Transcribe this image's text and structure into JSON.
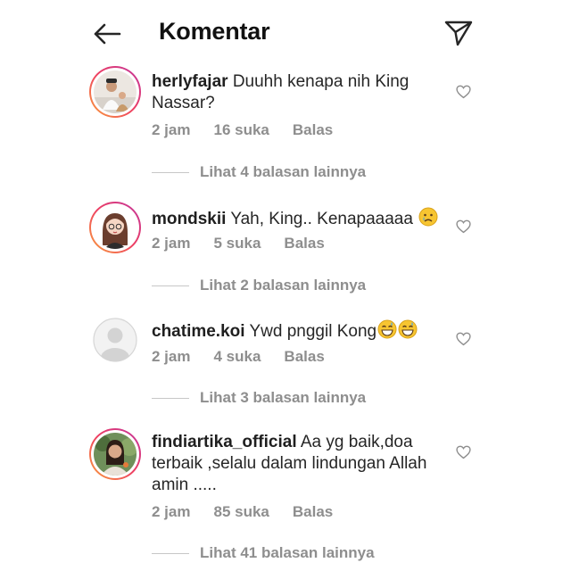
{
  "header": {
    "title": "Komentar",
    "back_icon": "arrow-left-icon",
    "send_icon": "paper-plane-icon"
  },
  "colors": {
    "text": "#262626",
    "meta": "#8e8e8e",
    "story_ring_start": "#f9a13a",
    "story_ring_end": "#c1359e"
  },
  "comments": [
    {
      "username": "herlyfajar",
      "text": "Duuhh kenapa nih King Nassar?",
      "time": "2 jam",
      "likes": "16 suka",
      "reply": "Balas",
      "view_replies": "Lihat 4 balasan lainnya",
      "avatar": "photo-avatar",
      "has_story": true
    },
    {
      "username": "mondskii",
      "text": "Yah, King.. Kenapaaaaa",
      "emoji": "crying-face-emoji",
      "time": "2 jam",
      "likes": "5 suka",
      "reply": "Balas",
      "view_replies": "Lihat 2 balasan lainnya",
      "avatar": "illustrated-avatar",
      "has_story": true
    },
    {
      "username": "chatime.koi",
      "text": "Ywd pnggil Kong",
      "emoji": "grinning-sweat-emoji x2",
      "time": "2 jam",
      "likes": "4 suka",
      "reply": "Balas",
      "view_replies": "Lihat 3 balasan lainnya",
      "avatar": "default-avatar",
      "has_story": false
    },
    {
      "username": "findiartika_official",
      "text": "Aa yg baik,doa terbaik ,selalu dalam lindungan Allah amin .....",
      "time": "2 jam",
      "likes": "85 suka",
      "reply": "Balas",
      "view_replies": "Lihat 41 balasan lainnya",
      "avatar": "photo-avatar",
      "has_story": true
    }
  ]
}
